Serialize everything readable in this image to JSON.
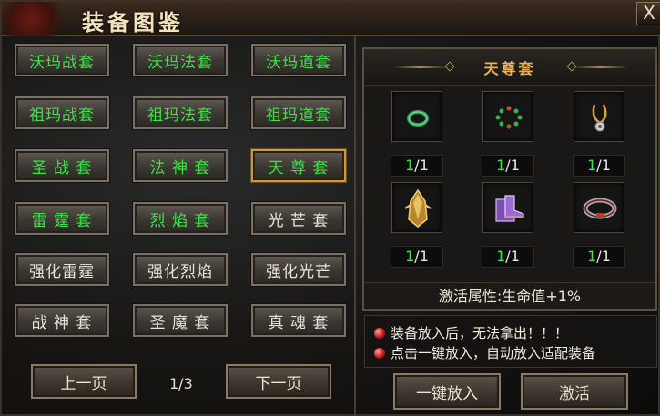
{
  "window": {
    "title": "装备图鉴",
    "close_glyph": "X"
  },
  "set_list": [
    {
      "label": "沃玛战套",
      "color": "green"
    },
    {
      "label": "沃玛法套",
      "color": "green"
    },
    {
      "label": "沃玛道套",
      "color": "green"
    },
    {
      "label": "祖玛战套",
      "color": "green"
    },
    {
      "label": "祖玛法套",
      "color": "green"
    },
    {
      "label": "祖玛道套",
      "color": "green"
    },
    {
      "label": "圣 战 套",
      "color": "green"
    },
    {
      "label": "法 神 套",
      "color": "green"
    },
    {
      "label": "天 尊 套",
      "color": "green",
      "selected": true
    },
    {
      "label": "雷 霆 套",
      "color": "green"
    },
    {
      "label": "烈 焰 套",
      "color": "green"
    },
    {
      "label": "光 芒 套",
      "color": "white"
    },
    {
      "label": "强化雷霆",
      "color": "white"
    },
    {
      "label": "强化烈焰",
      "color": "white"
    },
    {
      "label": "强化光芒",
      "color": "white"
    },
    {
      "label": "战 神 套",
      "color": "white"
    },
    {
      "label": "圣 魔 套",
      "color": "white"
    },
    {
      "label": "真 魂 套",
      "color": "white"
    }
  ],
  "pagination": {
    "prev_label": "上一页",
    "next_label": "下一页",
    "page": "1/3"
  },
  "detail": {
    "set_name": "天尊套",
    "slots": [
      {
        "icon": "jade-ring-icon",
        "have": "1",
        "need": "/1"
      },
      {
        "icon": "bead-bracelet-icon",
        "have": "1",
        "need": "/1"
      },
      {
        "icon": "gold-necklace-icon",
        "have": "1",
        "need": "/1"
      },
      {
        "icon": "golden-helmet-icon",
        "have": "1",
        "need": "/1"
      },
      {
        "icon": "purple-boots-icon",
        "have": "1",
        "need": "/1"
      },
      {
        "icon": "steel-belt-icon",
        "have": "1",
        "need": "/1"
      }
    ],
    "attribute": "激活属性:生命值+1%"
  },
  "notices": [
    "装备放入后，无法拿出！！！",
    "点击一键放入，自动放入适配装备"
  ],
  "actions": {
    "auto_fill_label": "一键放入",
    "activate_label": "激活"
  },
  "colors": {
    "green_text": "#3de24a",
    "gold_title": "#e9b25a",
    "selected_border": "#c89a3a"
  }
}
